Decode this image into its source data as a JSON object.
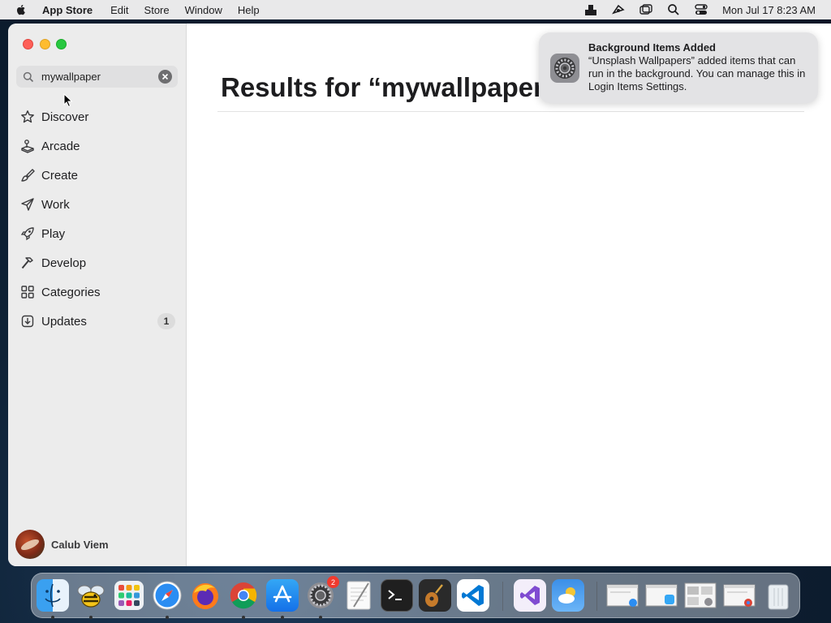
{
  "menubar": {
    "app_name": "App Store",
    "menus": [
      "Edit",
      "Store",
      "Window",
      "Help"
    ],
    "clock": "Mon Jul 17  8:23 AM",
    "status_icons": [
      "user-status-icon",
      "plugin-icon",
      "window-switch-icon",
      "spotlight-search-icon",
      "control-center-icon"
    ]
  },
  "sidebar": {
    "search_value": "mywallpaper",
    "items": [
      {
        "label": "Discover",
        "icon": "star-icon"
      },
      {
        "label": "Arcade",
        "icon": "joystick-icon"
      },
      {
        "label": "Create",
        "icon": "brush-icon"
      },
      {
        "label": "Work",
        "icon": "paper-plane-icon"
      },
      {
        "label": "Play",
        "icon": "rocket-icon"
      },
      {
        "label": "Develop",
        "icon": "hammer-icon"
      },
      {
        "label": "Categories",
        "icon": "grid-icon"
      },
      {
        "label": "Updates",
        "icon": "download-icon",
        "badge": "1"
      }
    ],
    "user_name": "Calub Viem"
  },
  "main": {
    "results_title": "Results for “mywallpaper”"
  },
  "notification": {
    "title": "Background Items Added",
    "body": "“Unsplash Wallpapers” added items that can run in the background. You can manage this in Login Items Settings."
  },
  "dock": {
    "apps": [
      {
        "name": "Finder",
        "icon": "finder-icon",
        "running": true
      },
      {
        "name": "Cyberduck",
        "icon": "bee-icon",
        "running": true
      },
      {
        "name": "Launchpad",
        "icon": "launchpad-icon",
        "running": false
      },
      {
        "name": "Safari",
        "icon": "safari-icon",
        "running": true
      },
      {
        "name": "Firefox",
        "icon": "firefox-icon",
        "running": false
      },
      {
        "name": "Chrome",
        "icon": "chrome-icon",
        "running": true
      },
      {
        "name": "App Store",
        "icon": "app-store-icon",
        "running": true
      },
      {
        "name": "System Settings",
        "icon": "settings-icon",
        "running": true,
        "badge": "2"
      },
      {
        "name": "TextEdit",
        "icon": "textedit-icon",
        "running": false
      },
      {
        "name": "Terminal",
        "icon": "terminal-icon",
        "running": false
      },
      {
        "name": "GarageBand",
        "icon": "guitar-icon",
        "running": false
      },
      {
        "name": "VS Code",
        "icon": "vscode-icon",
        "running": false
      },
      {
        "name": "Visual Studio",
        "icon": "visual-studio-icon",
        "running": false
      },
      {
        "name": "Weather",
        "icon": "weather-icon",
        "running": false
      }
    ],
    "recent_windows": [
      "window-thumbnail-icon",
      "window-thumbnail-icon",
      "window-thumbnail-icon",
      "window-thumbnail-icon"
    ],
    "trash": "trash-icon"
  }
}
